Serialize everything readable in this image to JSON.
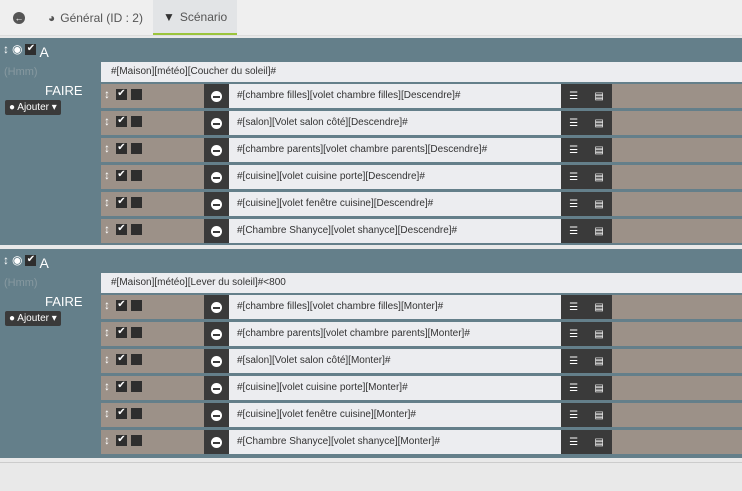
{
  "tabs": {
    "back": "back",
    "general": "Général (ID : 2)",
    "scenario": "Scénario"
  },
  "blocks": [
    {
      "label": "A",
      "hmm": "(Hmm)",
      "faire": "FAIRE",
      "add": "Ajouter",
      "condition": "#[Maison][météo][Coucher du soleil]#",
      "actions": [
        "#[chambre filles][volet chambre filles][Descendre]#",
        "#[salon][Volet salon côté][Descendre]#",
        "#[chambre parents][volet chambre parents][Descendre]#",
        "#[cuisine][volet cuisine porte][Descendre]#",
        "#[cuisine][volet fenêtre cuisine][Descendre]#",
        "#[Chambre Shanyce][volet shanyce][Descendre]#"
      ]
    },
    {
      "label": "A",
      "hmm": "(Hmm)",
      "faire": "FAIRE",
      "add": "Ajouter",
      "condition": "#[Maison][météo][Lever du soleil]#<800",
      "actions": [
        "#[chambre filles][volet chambre filles][Monter]#",
        "#[chambre parents][volet chambre parents][Monter]#",
        "#[salon][Volet salon côté][Monter]#",
        "#[cuisine][volet cuisine porte][Monter]#",
        "#[cuisine][volet fenêtre cuisine][Monter]#",
        "#[Chambre Shanyce][volet shanyce][Monter]#"
      ]
    }
  ]
}
